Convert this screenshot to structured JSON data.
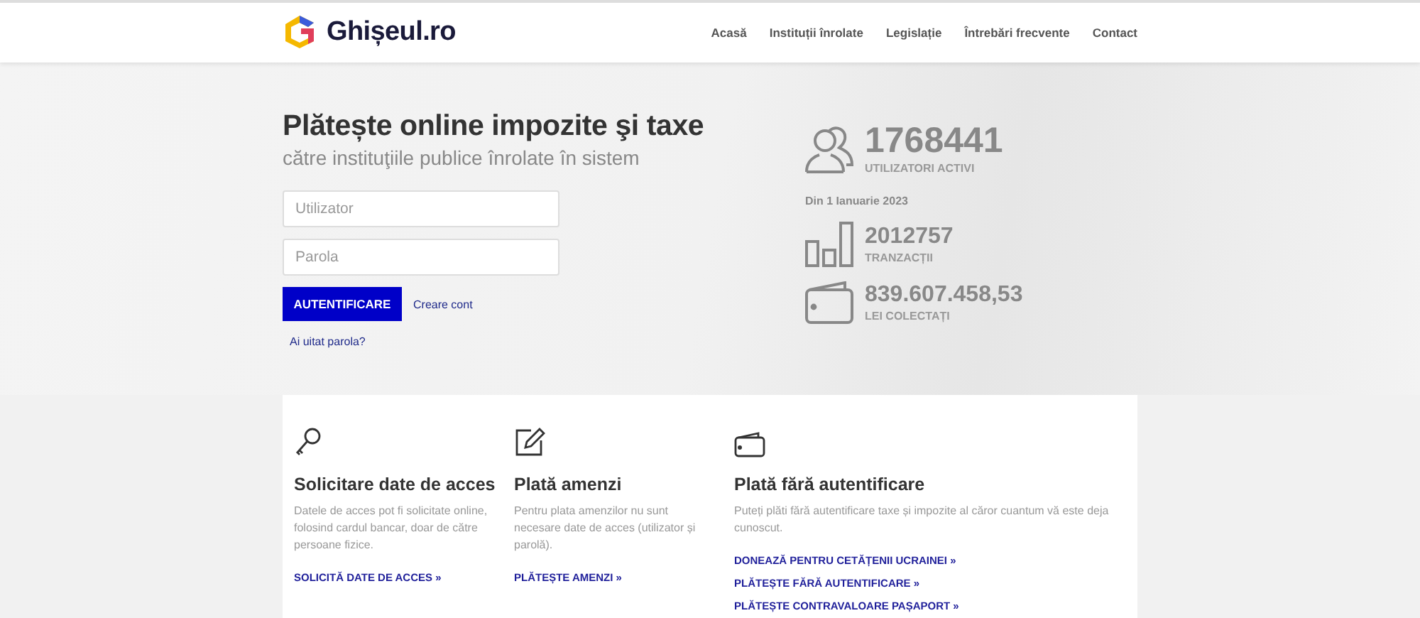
{
  "header": {
    "logo_text": "Ghișeul.ro",
    "nav": [
      "Acasă",
      "Instituții înrolate",
      "Legislație",
      "Întrebări frecvente",
      "Contact"
    ]
  },
  "hero": {
    "title": "Plătește online impozite şi taxe",
    "subtitle": "către instituţiile publice înrolate în sistem",
    "username_placeholder": "Utilizator",
    "password_placeholder": "Parola",
    "login_button": "AUTENTIFICARE",
    "create_account_link": "Creare cont",
    "forgot_password_link": "Ai uitat parola?"
  },
  "stats": {
    "users": {
      "value": "1768441",
      "label": "UTILIZATORI ACTIVI"
    },
    "since": "Din 1 Ianuarie 2023",
    "items": [
      {
        "kind": "chart",
        "value": "2012757",
        "label": "TRANZACȚII"
      },
      {
        "kind": "wallet",
        "value": "839.607.458,53",
        "label": "LEI COLECTAȚI"
      }
    ]
  },
  "features": [
    {
      "kind": "key",
      "title": "Solicitare date de acces",
      "description": "Datele de acces pot fi solicitate online, folosind cardul bancar, doar de către persoane fizice.",
      "links": [
        "SOLICITĂ DATE DE ACCES »"
      ]
    },
    {
      "kind": "edit",
      "title": "Plată amenzi",
      "description": "Pentru plata amenzilor nu sunt necesare date de acces (utilizator și parolă).",
      "links": [
        "PLĂTEȘTE AMENZI »"
      ]
    },
    {
      "kind": "wallet",
      "title": "Plată fără autentificare",
      "description": "Puteți plăti fără autentificare taxe și impozite al căror cuantum vă este deja cunoscut.",
      "links": [
        "DONEAZĂ PENTRU CETĂȚENII UCRAINEI »",
        "PLĂTEȘTE FĂRĂ AUTENTIFICARE »",
        "PLĂTEȘTE CONTRAVALOARE PAȘAPORT »"
      ]
    }
  ]
}
